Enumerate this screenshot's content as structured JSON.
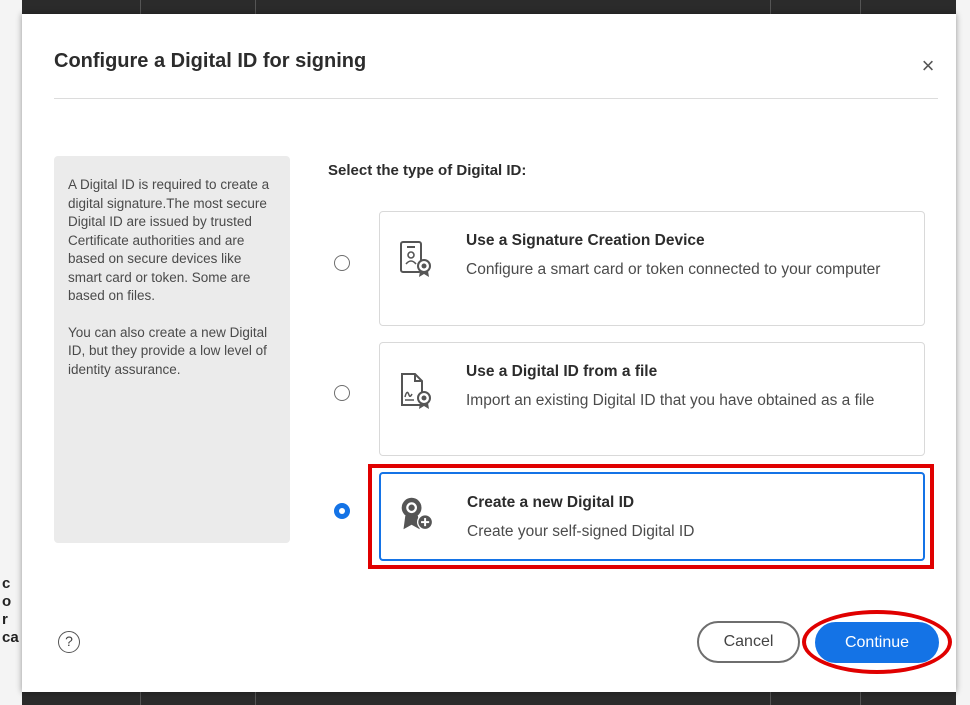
{
  "dialog": {
    "title": "Configure a Digital ID for signing",
    "close_symbol": "×"
  },
  "info_panel": {
    "paragraph1": "A Digital ID is required to create a digital signature.The most secure Digital ID are issued by trusted Certificate authorities and are based on secure devices like smart card or token. Some are based on files.",
    "paragraph2": "You can also create a new Digital ID, but they provide a low level of identity assurance."
  },
  "prompt": "Select the type of Digital ID:",
  "options": [
    {
      "title": "Use a Signature Creation Device",
      "description": "Configure a smart card or token connected to your computer",
      "icon": "certificate-device-icon",
      "selected": false
    },
    {
      "title": "Use a Digital ID from a file",
      "description": "Import an existing Digital ID that you have obtained as a file",
      "icon": "certificate-file-icon",
      "selected": false
    },
    {
      "title": "Create a new Digital ID",
      "description": "Create your self-signed Digital ID",
      "icon": "create-digital-id-icon",
      "selected": true
    }
  ],
  "footer": {
    "help_symbol": "?",
    "cancel_label": "Cancel",
    "continue_label": "Continue"
  },
  "background_text": "c\no\nr\nca",
  "colors": {
    "accent": "#1473e6",
    "annotation": "#e00000"
  }
}
